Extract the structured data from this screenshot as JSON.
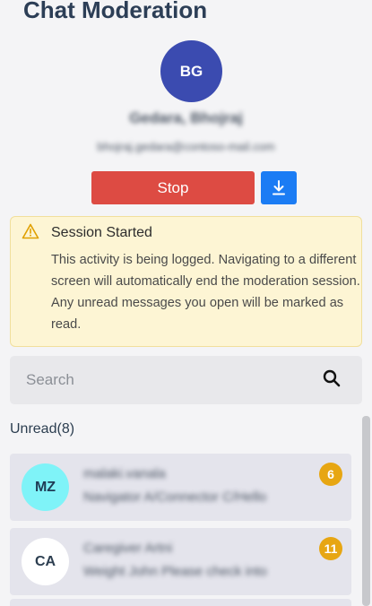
{
  "header": {
    "title": "Chat Moderation"
  },
  "profile": {
    "initials": "BG",
    "avatar_color": "#3b4bb0",
    "name": "Gedara, Bhojraj",
    "email": "bhojraj.gedara@contoso-mail.com"
  },
  "actions": {
    "stop_label": "Stop",
    "stop_color": "#dd4b43",
    "download_icon": "download-icon",
    "download_color": "#1b7cf4"
  },
  "alert": {
    "icon": "warning-icon",
    "title": "Session Started",
    "message": "This activity is being logged. Navigating to a different screen will automatically end the moderation session. Any unread messages you open will be marked as read."
  },
  "search": {
    "placeholder": "Search",
    "value": "",
    "icon": "search-icon"
  },
  "unread": {
    "label": "Unread",
    "count_text": "(8)",
    "items": [
      {
        "initials": "MZ",
        "avatar_color": "#7ff3f8",
        "avatar_text_color": "#1f3b55",
        "line1": "malaki.vanala",
        "line2": "Navigator A/Connector C/Hello",
        "badge": "6"
      },
      {
        "initials": "CA",
        "avatar_color": "#ffffff",
        "avatar_text_color": "#2c3e50",
        "line1": "Caregiver Artni",
        "line2": "Weight John Please check into",
        "badge": "11"
      }
    ]
  }
}
